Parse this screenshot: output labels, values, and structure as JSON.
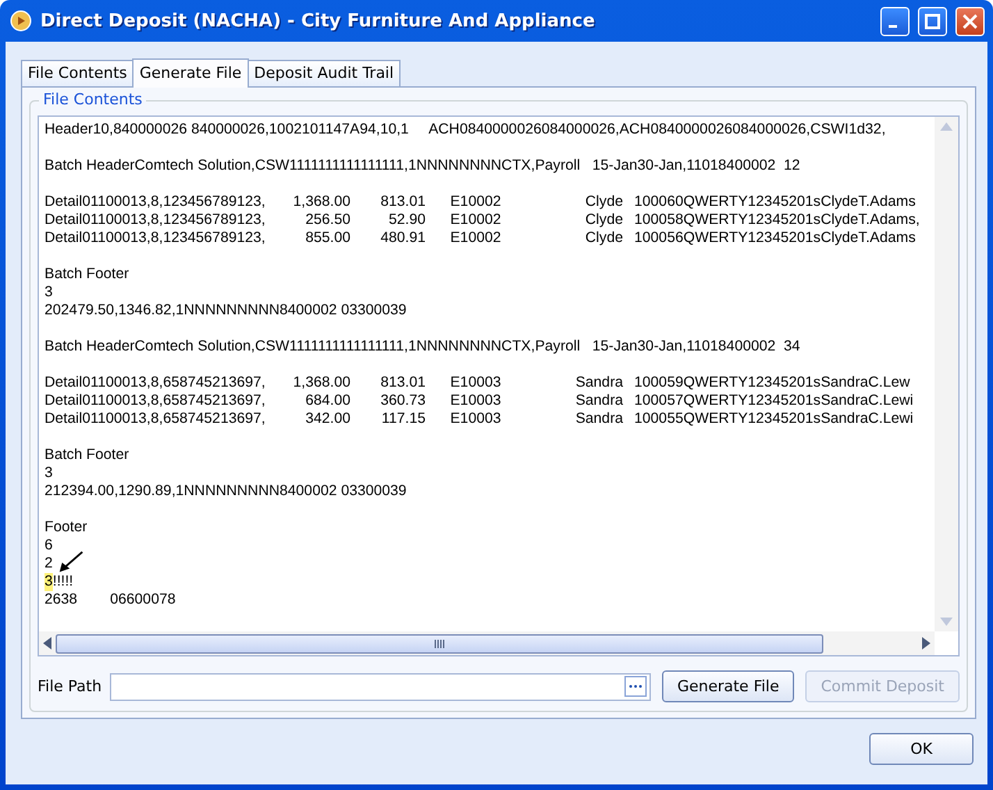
{
  "window": {
    "title": "Direct Deposit (NACHA) - City Furniture And Appliance"
  },
  "tabs": [
    {
      "label": "File Contents",
      "selected": false
    },
    {
      "label": "Generate File",
      "selected": true
    },
    {
      "label": "Deposit Audit Trail",
      "selected": false
    }
  ],
  "group": {
    "title": "File Contents"
  },
  "file_lines": [
    {
      "kind": "text",
      "text": "Header10,840000026 840000026,1002101147A94,10,1     ACH0840000026084000026,ACH0840000026084000026,CSWI1d32,"
    },
    {
      "kind": "blank"
    },
    {
      "kind": "text",
      "text": "Batch HeaderComtech Solution,CSW1111111111111111,1NNNNNNNNCTX,Payroll   15-Jan30-Jan,11018400002  12"
    },
    {
      "kind": "blank"
    },
    {
      "kind": "row",
      "cells": [
        "Detail01100013,8,123456789123,",
        "1,368.00",
        "813.01",
        "E10002",
        "Clyde",
        "100060QWERTY12345201sClydeT.Adams"
      ]
    },
    {
      "kind": "row",
      "cells": [
        "Detail01100013,8,123456789123,",
        "256.50",
        "52.90",
        "E10002",
        "Clyde",
        "100058QWERTY12345201sClydeT.Adams,"
      ]
    },
    {
      "kind": "row",
      "cells": [
        "Detail01100013,8,123456789123,",
        "855.00",
        "480.91",
        "E10002",
        "Clyde",
        "100056QWERTY12345201sClydeT.Adams"
      ]
    },
    {
      "kind": "blank"
    },
    {
      "kind": "text",
      "text": "Batch Footer"
    },
    {
      "kind": "text",
      "text": "3"
    },
    {
      "kind": "text",
      "text": "202479.50,1346.82,1NNNNNNNNN8400002 03300039"
    },
    {
      "kind": "blank"
    },
    {
      "kind": "text",
      "text": "Batch HeaderComtech Solution,CSW1111111111111111,1NNNNNNNNCTX,Payroll   15-Jan30-Jan,11018400002  34"
    },
    {
      "kind": "blank"
    },
    {
      "kind": "row",
      "cells": [
        "Detail01100013,8,658745213697,",
        "1,368.00",
        "813.01",
        "E10003",
        "Sandra",
        "100059QWERTY12345201sSandraC.Lew"
      ]
    },
    {
      "kind": "row",
      "cells": [
        "Detail01100013,8,658745213697,",
        "684.00",
        "360.73",
        "E10003",
        "Sandra",
        "100057QWERTY12345201sSandraC.Lewi"
      ]
    },
    {
      "kind": "row",
      "cells": [
        "Detail01100013,8,658745213697,",
        "342.00",
        "117.15",
        "E10003",
        "Sandra",
        "100055QWERTY12345201sSandraC.Lewi"
      ]
    },
    {
      "kind": "blank"
    },
    {
      "kind": "text",
      "text": "Batch Footer"
    },
    {
      "kind": "text",
      "text": "3"
    },
    {
      "kind": "text",
      "text": "212394.00,1290.89,1NNNNNNNNN8400002 03300039"
    },
    {
      "kind": "blank"
    },
    {
      "kind": "text",
      "text": "Footer"
    },
    {
      "kind": "text",
      "text": "6"
    },
    {
      "kind": "text",
      "text": "2"
    },
    {
      "kind": "marked",
      "mark": "3",
      "text": "!!!!!"
    },
    {
      "kind": "text",
      "text": "2638        06600078"
    }
  ],
  "file_path": {
    "label": "File Path"
  },
  "buttons": [
    {
      "label": "Generate File",
      "disabled": false
    },
    {
      "label": "Commit Deposit",
      "disabled": true
    }
  ],
  "ok_button": {
    "label": "OK"
  }
}
